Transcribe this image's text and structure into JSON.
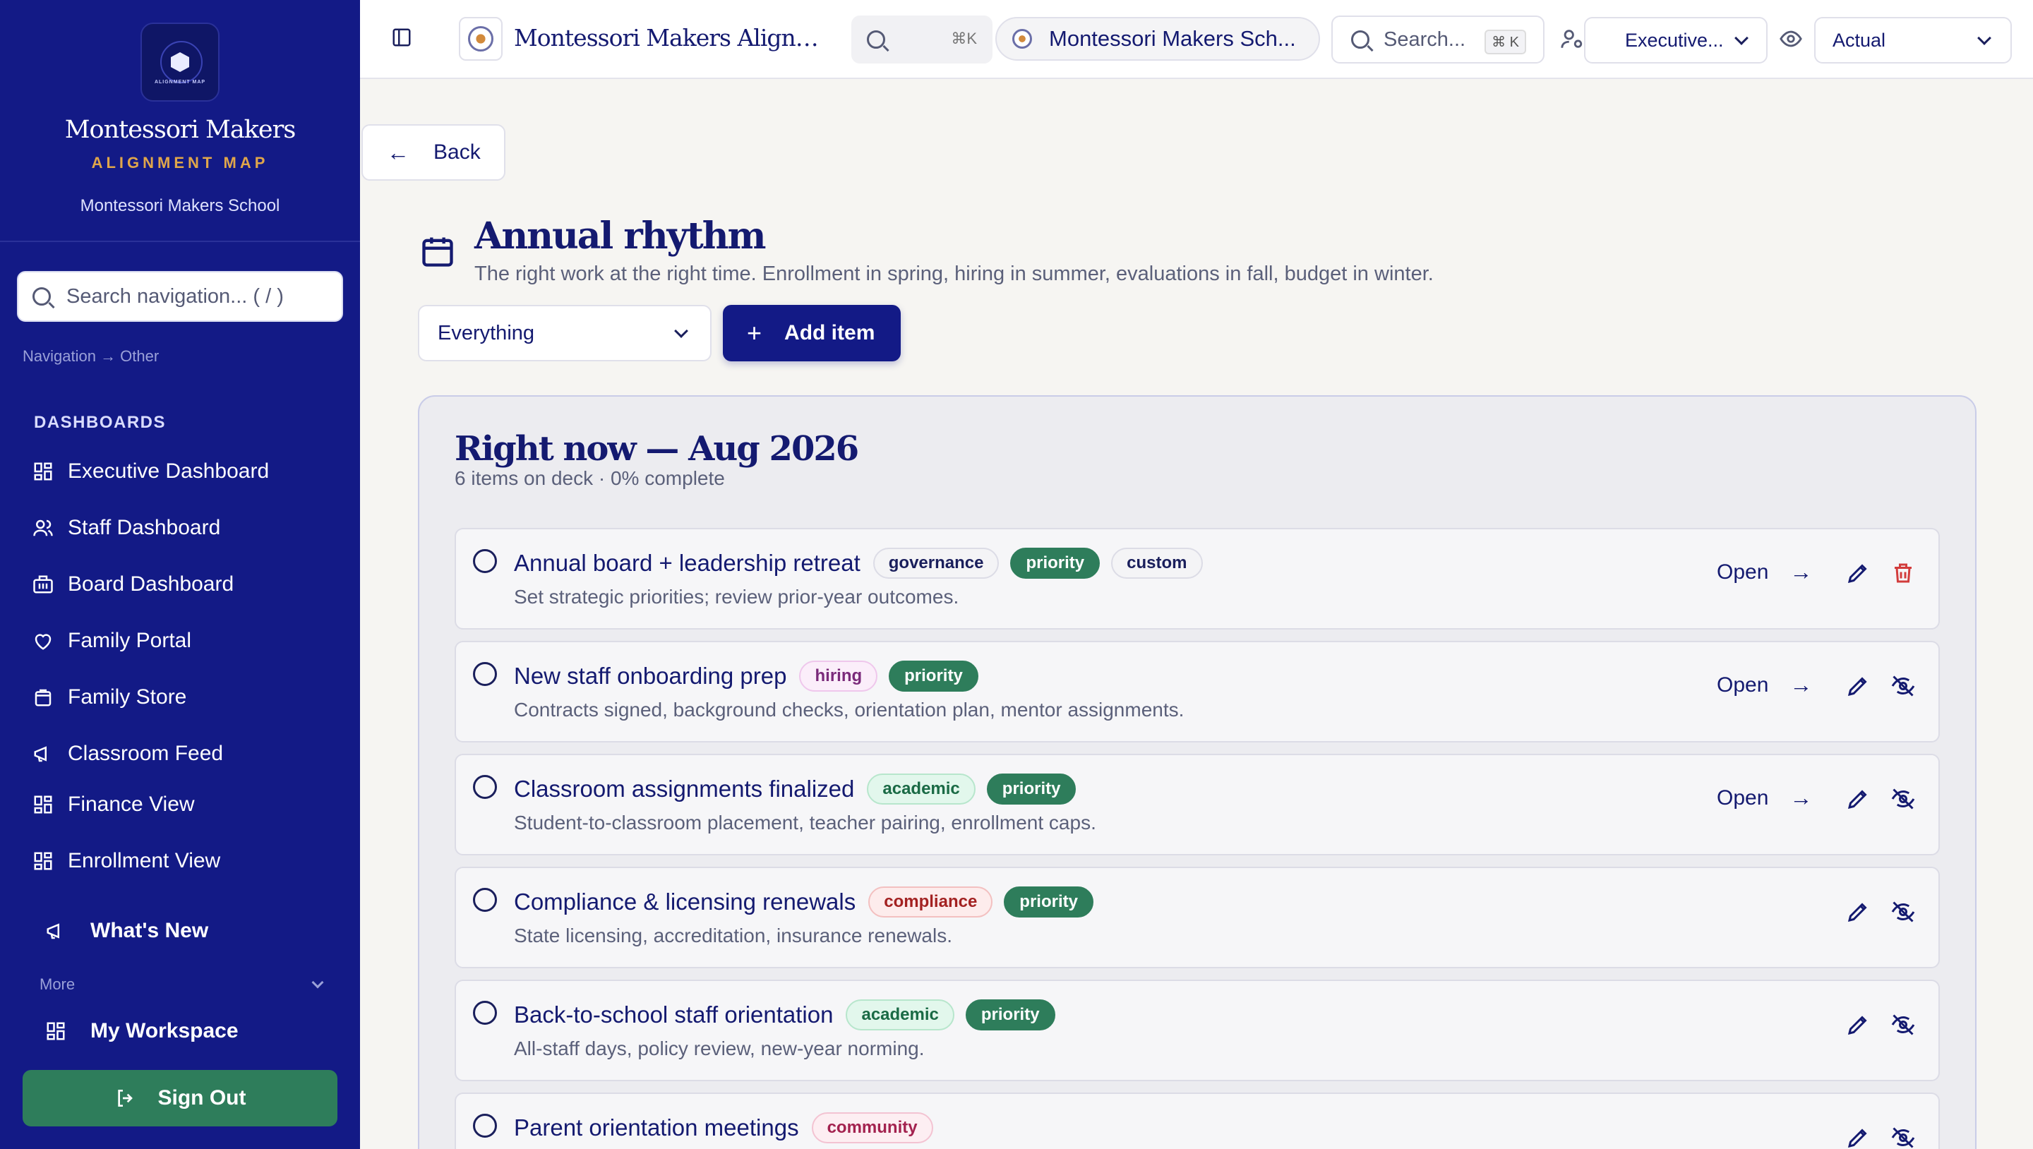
{
  "sidebar": {
    "logo_text": "ALIGNMENT MAP",
    "brand_name": "Montessori Makers",
    "brand_sub": "ALIGNMENT MAP",
    "school": "Montessori Makers School",
    "search_placeholder": "Search navigation... ( / )",
    "breadcrumb": "Navigation → Other",
    "section_heading": "DASHBOARDS",
    "items": [
      {
        "label": "Executive Dashboard",
        "icon": "grid-icon"
      },
      {
        "label": "Staff Dashboard",
        "icon": "users-icon"
      },
      {
        "label": "Board Dashboard",
        "icon": "building-icon"
      },
      {
        "label": "Family Portal",
        "icon": "heart-icon"
      },
      {
        "label": "Family Store",
        "icon": "shopping-bag-icon"
      },
      {
        "label": "Classroom Feed",
        "icon": "megaphone-icon"
      },
      {
        "label": "Finance View",
        "icon": "grid-icon"
      },
      {
        "label": "Enrollment View",
        "icon": "grid-icon"
      }
    ],
    "whats_new": "What's New",
    "more_label": "More",
    "workspace": "My Workspace",
    "sign_out": "Sign Out"
  },
  "topbar": {
    "app_title": "Montessori Makers Alignmen...",
    "search_kbd": "⌘K",
    "school_pill": "Montessori Makers Sch...",
    "search_placeholder": "Search...",
    "search_kbd2": "⌘ K",
    "role_select": "Executive...",
    "mode_select": "Actual"
  },
  "main": {
    "back_label": "Back",
    "title": "Annual rhythm",
    "description": "The right work at the right time. Enrollment in spring, hiring in summer, evaluations in fall, budget in winter.",
    "filter_value": "Everything",
    "add_label": "Add item",
    "panel_title": "Right now — Aug 2026",
    "panel_sub": "6 items on deck · 0% complete",
    "open_label": "Open",
    "items": [
      {
        "title": "Annual board + leadership retreat",
        "tags": [
          {
            "label": "governance",
            "kind": "neutral"
          },
          {
            "label": "priority",
            "kind": "priority"
          },
          {
            "label": "custom",
            "kind": "neutral"
          }
        ],
        "desc": "Set strategic priorities; review prior-year outcomes.",
        "has_open": true,
        "second_action": "trash-icon"
      },
      {
        "title": "New staff onboarding prep",
        "tags": [
          {
            "label": "hiring",
            "kind": "hiring"
          },
          {
            "label": "priority",
            "kind": "priority"
          }
        ],
        "desc": "Contracts signed, background checks, orientation plan, mentor assignments.",
        "has_open": true,
        "second_action": "eye-off-icon"
      },
      {
        "title": "Classroom assignments finalized",
        "tags": [
          {
            "label": "academic",
            "kind": "academic"
          },
          {
            "label": "priority",
            "kind": "priority"
          }
        ],
        "desc": "Student-to-classroom placement, teacher pairing, enrollment caps.",
        "has_open": true,
        "second_action": "eye-off-icon"
      },
      {
        "title": "Compliance & licensing renewals",
        "tags": [
          {
            "label": "compliance",
            "kind": "compliance"
          },
          {
            "label": "priority",
            "kind": "priority"
          }
        ],
        "desc": "State licensing, accreditation, insurance renewals.",
        "has_open": false,
        "second_action": "eye-off-icon"
      },
      {
        "title": "Back-to-school staff orientation",
        "tags": [
          {
            "label": "academic",
            "kind": "academic"
          },
          {
            "label": "priority",
            "kind": "priority"
          }
        ],
        "desc": "All-staff days, policy review, new-year norming.",
        "has_open": false,
        "second_action": "eye-off-icon"
      },
      {
        "title": "Parent orientation meetings",
        "tags": [
          {
            "label": "community",
            "kind": "community"
          }
        ],
        "desc": "",
        "has_open": false,
        "second_action": "eye-off-icon"
      }
    ]
  }
}
